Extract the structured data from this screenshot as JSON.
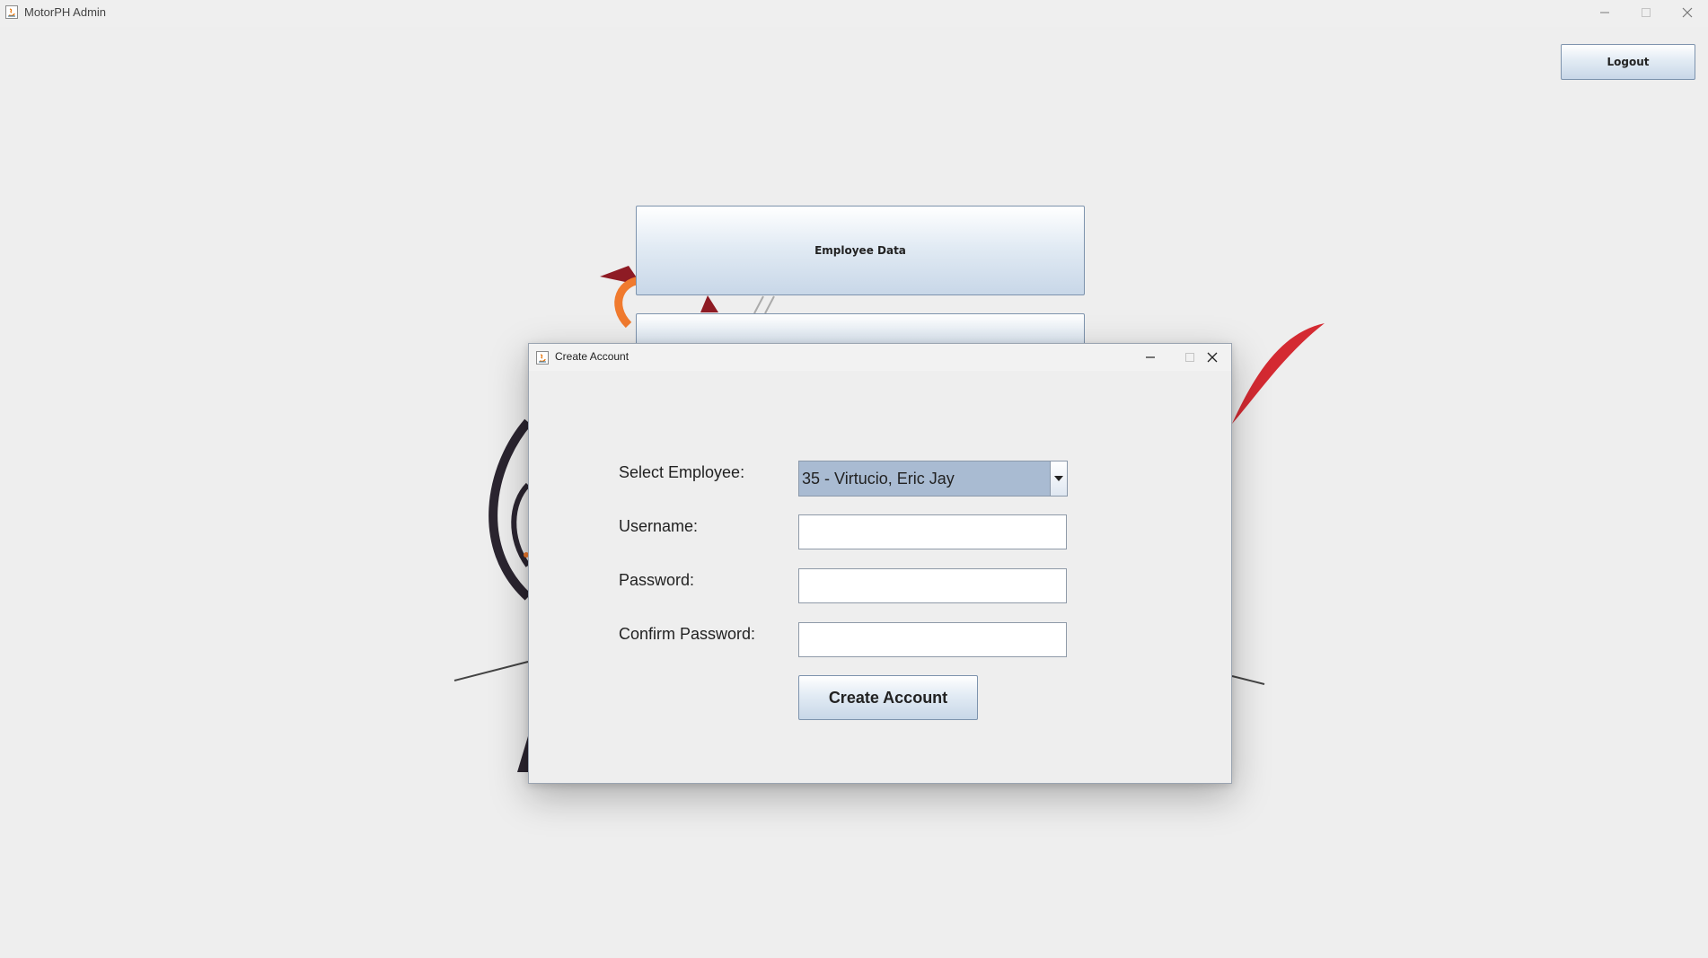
{
  "window": {
    "title": "MotorPH Admin",
    "controls": [
      "minimize-icon",
      "maximize-icon",
      "close-icon"
    ]
  },
  "header": {
    "logout_label": "Logout"
  },
  "main_menu": {
    "items": [
      {
        "label": "Employee Data"
      },
      {
        "label": ""
      }
    ]
  },
  "dialog": {
    "title": "Create Account",
    "fields": {
      "employee_label": "Select Employee:",
      "employee_value": "35 - Virtucio, Eric Jay",
      "username_label": "Username:",
      "username_value": "",
      "password_label": "Password:",
      "password_value": "",
      "confirm_label": "Confirm Password:",
      "confirm_value": ""
    },
    "submit_label": "Create Account"
  },
  "colors": {
    "window_bg": "#eeeeee",
    "button_border": "#7d93ad",
    "combo_selected_bg": "#a9bbd2",
    "logo_red": "#d42a32",
    "logo_orange": "#f07a2e",
    "logo_dark": "#2b2530"
  }
}
